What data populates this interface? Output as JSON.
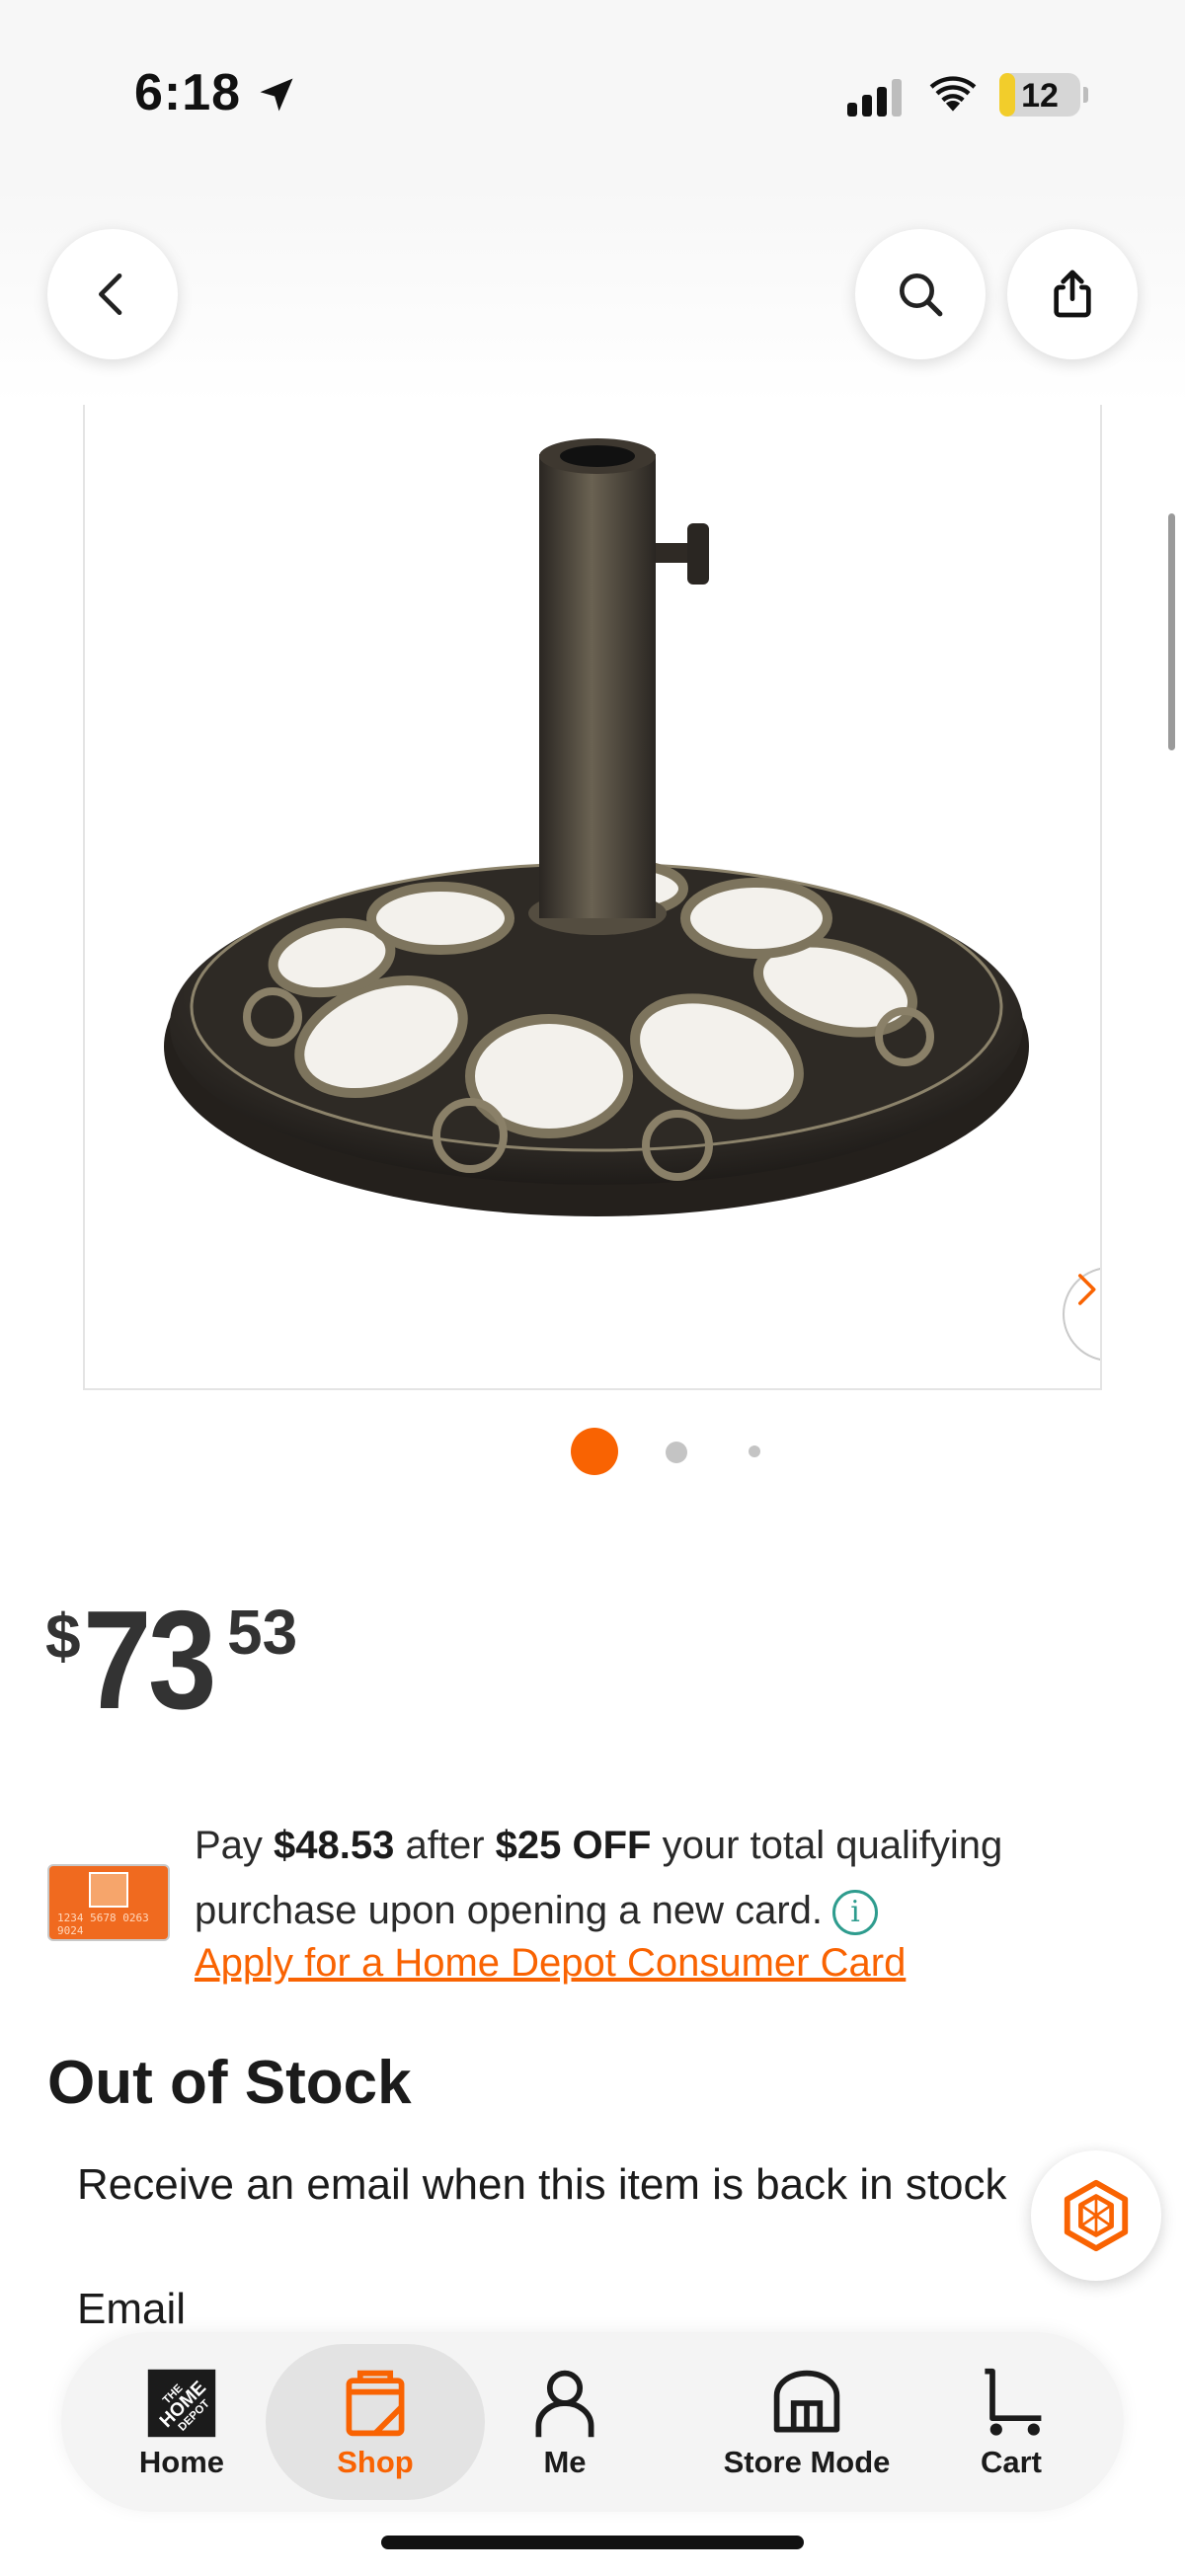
{
  "status_bar": {
    "time": "6:18",
    "battery_level": "12",
    "battery_fraction": 0.12
  },
  "header": {
    "back_icon": "chevron-left-icon",
    "search_icon": "search-icon",
    "share_icon": "share-icon"
  },
  "gallery": {
    "image_alt": "Cast iron umbrella base with bronze finish",
    "image_count": 3,
    "active_index": 0,
    "next_icon": "chevron-right-icon"
  },
  "price": {
    "currency": "$",
    "dollars": "73",
    "cents": "53"
  },
  "credit_offer": {
    "pay_prefix": "Pay ",
    "pay_amount": "$48.53",
    "after_text": " after ",
    "discount": "$25 OFF",
    "rest_text": " your total qualifying purchase upon opening a new card.",
    "card_number": "1234 5678 0263 9024",
    "apply_link": "Apply for a Home Depot Consumer Card"
  },
  "stock": {
    "title": "Out of Stock",
    "description": "Receive an email when this item is back in stock",
    "email_label": "Email"
  },
  "bottom_nav": {
    "items": [
      {
        "label": "Home",
        "icon": "home-depot-logo-icon"
      },
      {
        "label": "Shop",
        "icon": "shop-icon",
        "active": true
      },
      {
        "label": "Me",
        "icon": "person-icon"
      },
      {
        "label": "Store Mode",
        "icon": "store-icon"
      },
      {
        "label": "Cart",
        "icon": "cart-icon"
      }
    ]
  },
  "colors": {
    "accent": "#f96302",
    "info": "#2e9c8e",
    "text": "#1b1b1b",
    "battery_low": "#f2cd2b"
  }
}
